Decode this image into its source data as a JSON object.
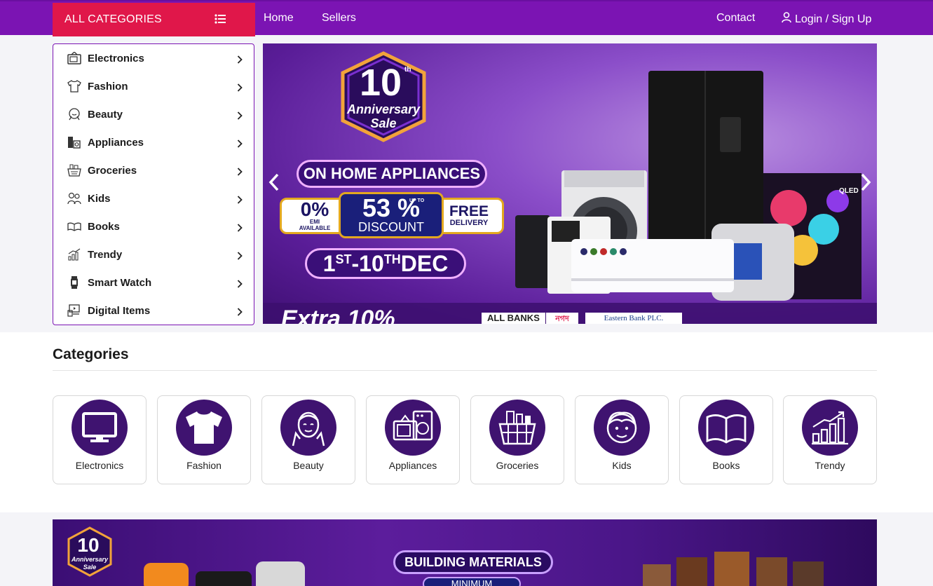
{
  "nav": {
    "all_categories": "ALL CATEGORIES",
    "home": "Home",
    "sellers": "Sellers",
    "contact": "Contact",
    "login": "Login / Sign Up",
    "bg_color": "#7b14b3",
    "accent_color": "#e0174a"
  },
  "sidebar": {
    "items": [
      {
        "label": "Electronics",
        "icon": "tv-icon"
      },
      {
        "label": "Fashion",
        "icon": "tshirt-icon"
      },
      {
        "label": "Beauty",
        "icon": "beauty-face-icon"
      },
      {
        "label": "Appliances",
        "icon": "appliance-icon"
      },
      {
        "label": "Groceries",
        "icon": "basket-icon"
      },
      {
        "label": "Kids",
        "icon": "kids-icon"
      },
      {
        "label": "Books",
        "icon": "book-icon"
      },
      {
        "label": "Trendy",
        "icon": "chart-icon"
      },
      {
        "label": "Smart Watch",
        "icon": "watch-icon"
      },
      {
        "label": "Digital Items",
        "icon": "digital-icon"
      }
    ]
  },
  "hero": {
    "badge_num": "10",
    "badge_th": "th",
    "badge_text1": "Anniversary",
    "badge_text2": "Sale",
    "headline": "ON HOME APPLIANCES",
    "emi_value": "0%",
    "emi_label": "EMI",
    "emi_sub": "AVAILABLE",
    "discount_value": "53 %",
    "discount_upto": "UP TO",
    "discount_label": "DISCOUNT",
    "free_line1": "FREE",
    "free_line2": "DELIVERY",
    "date_st": "ST",
    "date_th": "TH",
    "date_pre": "1",
    "date_mid": "-10",
    "date_post": " DEC",
    "extra_text": "Extra 10%",
    "banks_label": "ALL BANKS",
    "bank1": "নগদ",
    "bank2": "Eastern Bank PLC."
  },
  "categories": {
    "title": "Categories",
    "cards": [
      {
        "label": "Electronics",
        "icon": "monitor-icon"
      },
      {
        "label": "Fashion",
        "icon": "tshirt-icon"
      },
      {
        "label": "Beauty",
        "icon": "beauty-face-icon"
      },
      {
        "label": "Appliances",
        "icon": "appliance-icon"
      },
      {
        "label": "Groceries",
        "icon": "basket-icon"
      },
      {
        "label": "Kids",
        "icon": "kid-face-icon"
      },
      {
        "label": "Books",
        "icon": "open-book-icon"
      },
      {
        "label": "Trendy",
        "icon": "trend-chart-icon"
      }
    ]
  },
  "banner2": {
    "badge_text1": "Anniversary",
    "badge_text2": "Sale",
    "headline": "BUILDING MATERIALS",
    "sub": "MINIMUM"
  }
}
